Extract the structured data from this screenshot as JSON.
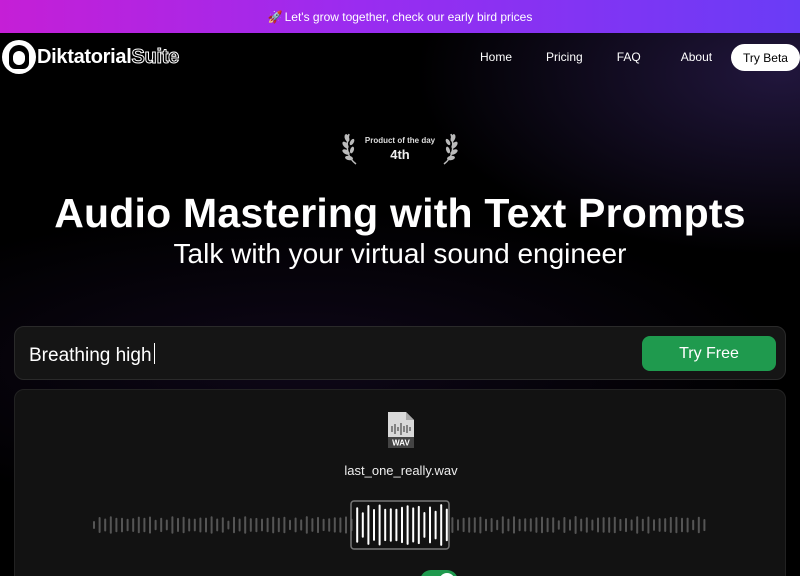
{
  "banner": {
    "icon": "rocket-icon",
    "text": "Let's grow together, check our early bird prices"
  },
  "brand": {
    "name_bold": "Diktatorial",
    "name_outline": "Suite",
    "logo_icon": "headphones-face-icon"
  },
  "nav": {
    "links": [
      "Home",
      "Pricing",
      "FAQ",
      "About"
    ],
    "cta": "Try Beta"
  },
  "badge": {
    "label": "Product of the day",
    "rank": "4th"
  },
  "hero": {
    "title": "Audio Mastering with Text Prompts",
    "subtitle": "Talk with your virtual sound engineer"
  },
  "prompt": {
    "value": "Breathing high",
    "button": "Try Free"
  },
  "player": {
    "file_icon": "wav-file-icon",
    "file_icon_label": "WAV",
    "file_name": "last_one_really.wav",
    "enhance_toggle_on": true
  },
  "colors": {
    "accent_green": "#1f9a4e",
    "banner_start": "#c51fd6",
    "banner_end": "#6a3cf6"
  }
}
